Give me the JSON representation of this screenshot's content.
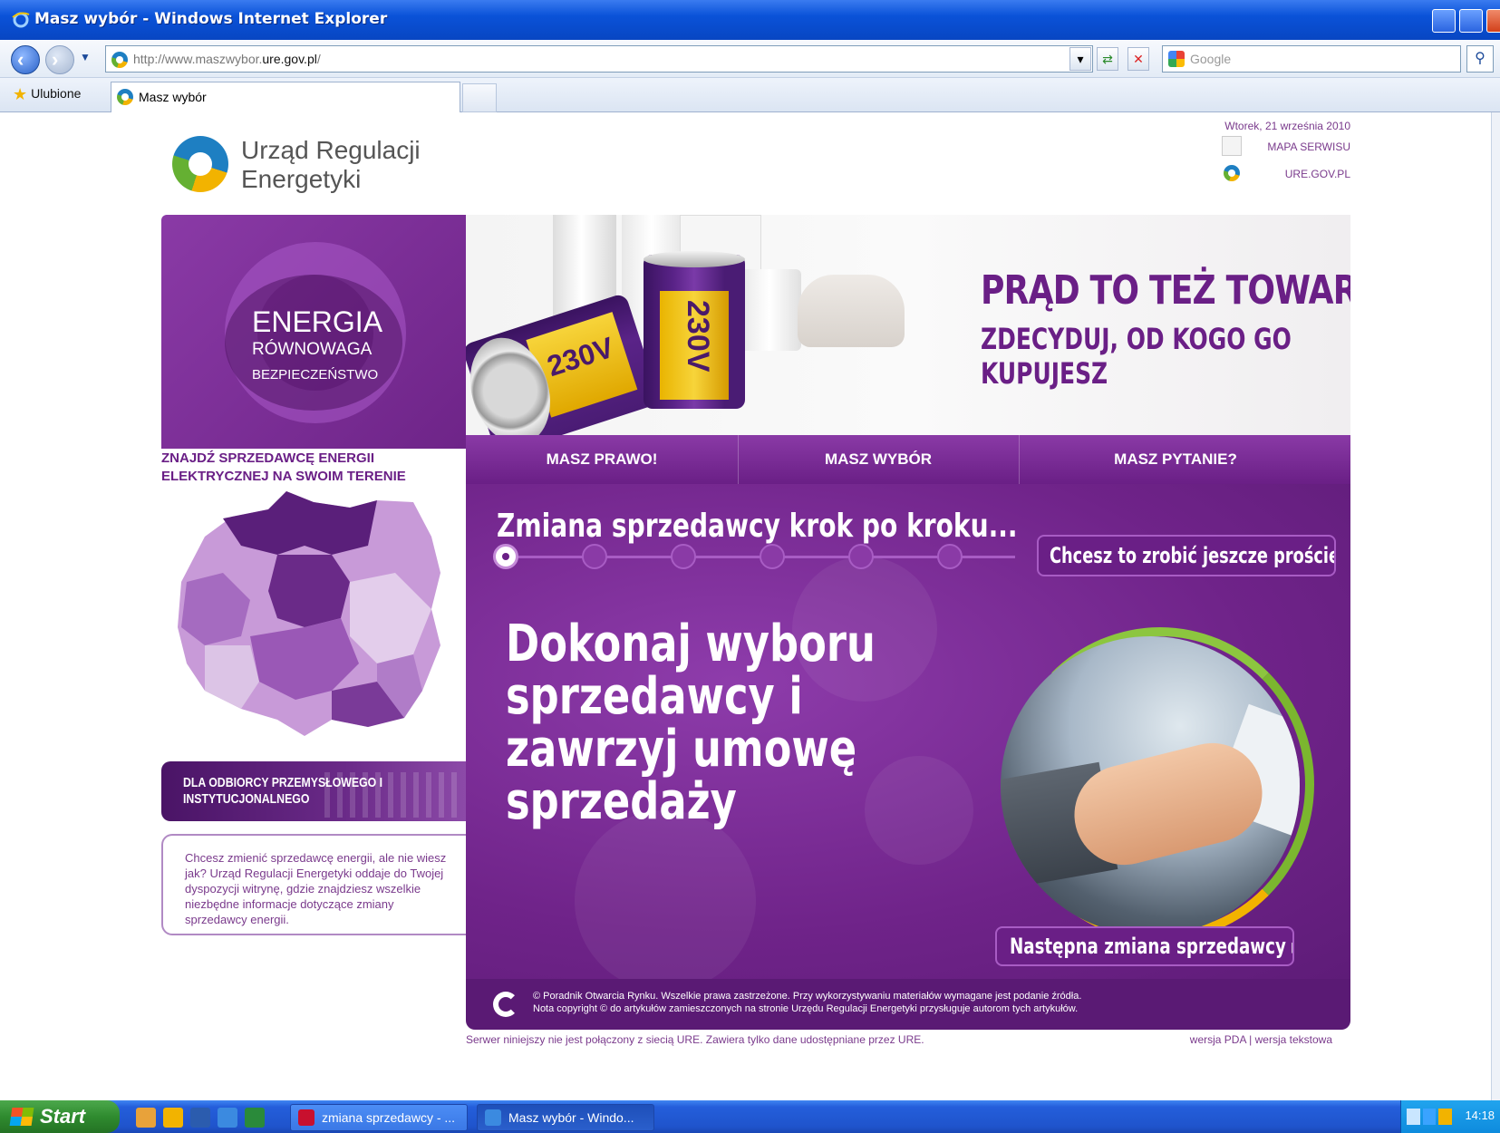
{
  "window": {
    "title": "Masz wybór - Windows Internet Explorer"
  },
  "browser": {
    "url_prefix": "http://www.maszwybor.",
    "url_domain": "ure.gov.pl",
    "url_suffix": "/",
    "search_placeholder": "Google",
    "favorites_label": "Ulubione",
    "tab_title": "Masz wybór"
  },
  "page": {
    "logo_text": "Urząd Regulacji Energetyki",
    "date": "Wtorek, 21 września 2010",
    "top_links": [
      "MAPA SERWISU",
      "URE.GOV.PL"
    ],
    "energy_box": {
      "line1": "ENERGIA",
      "line2": "RÓWNOWAGA",
      "line3": "BEZPIECZEŃSTWO"
    },
    "hero": {
      "headline": "PRĄD TO TEŻ TOWAR",
      "subheadline": "ZDECYDUJ, OD KOGO GO KUPUJESZ",
      "can_label": "230V"
    },
    "finder_title": "ZNAJDŹ SPRZEDAWCĘ ENERGII ELEKTRYCZNEJ NA SWOIM TERENIE",
    "industrial_link": "DLA ODBIORCY PRZEMYSŁOWEGO I INSTYTUCJONALNEGO",
    "info_text": "Chcesz zmienić sprzedawcę energii, ale nie wiesz jak? Urząd Regulacji Energetyki oddaje do Twojej dyspozycji witrynę, gdzie znajdziesz wszelkie niezbędne informacje dotyczące zmiany sprzedawcy energii.",
    "tabs": [
      "MASZ PRAWO!",
      "MASZ WYBÓR",
      "MASZ PYTANIE?"
    ],
    "steps_title": "Zmiana sprzedawcy krok po kroku...",
    "steps": {
      "total": 6,
      "active": 1
    },
    "simpler_button": "Chcesz to zrobić jeszcze prościej?",
    "main_headline": "Dokonaj wyboru sprzedawcy i zawrzyj umowę sprzedaży",
    "next_button": "Następna zmiana sprzedawcy ▸",
    "footer_line1": "© Poradnik Otwarcia Rynku. Wszelkie prawa zastrzeżone. Przy wykorzystywaniu materiałów wymagane jest podanie źródła.",
    "footer_line2": "Nota copyright © do artykułów zamieszczonych na stronie Urzędu Regulacji Energetyki przysługuje autorom tych artykułów.",
    "bottom_note": "Serwer niniejszy nie jest połączony z siecią URE. Zawiera tylko dane udostępniane przez URE.",
    "bottom_links": [
      "wersja PDA",
      "wersja tekstowa"
    ],
    "bottom_separator": "|"
  },
  "taskbar": {
    "start_label": "Start",
    "tasks": [
      "zmiana sprzedawcy - ...",
      "Masz wybór - Windo..."
    ],
    "clock": "14:18"
  },
  "colors": {
    "brand_purple": "#6a1f86",
    "accent_yellow": "#f2b300",
    "accent_green": "#65b032"
  }
}
